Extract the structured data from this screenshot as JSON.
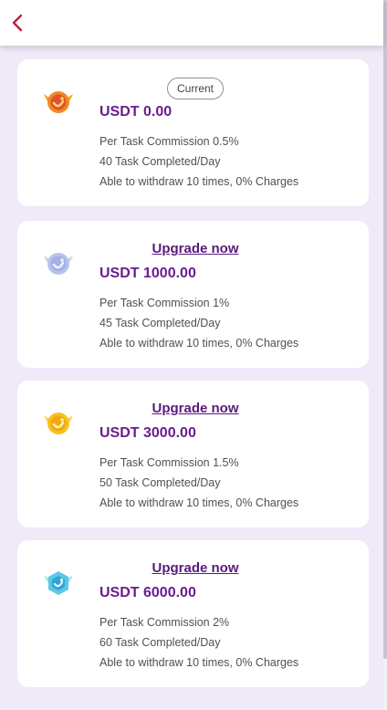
{
  "header": {
    "back_icon": "chevron-left-icon",
    "accent_color": "#c0203a"
  },
  "plans": [
    {
      "icon": "orange-medal-icon",
      "status_label": "Current",
      "price": "USDT 0.00",
      "commission": "Per Task Commission 0.5%",
      "tasks": "40 Task Completed/Day",
      "withdraw": "Able to withdraw 10 times, 0% Charges"
    },
    {
      "icon": "silver-medal-icon",
      "action_label": "Upgrade now",
      "price": "USDT 1000.00",
      "commission": "Per Task Commission 1%",
      "tasks": "45 Task Completed/Day",
      "withdraw": "Able to withdraw 10 times, 0% Charges"
    },
    {
      "icon": "gold-medal-icon",
      "action_label": "Upgrade now",
      "price": "USDT 3000.00",
      "commission": "Per Task Commission 1.5%",
      "tasks": "50 Task Completed/Day",
      "withdraw": "Able to withdraw 10 times, 0% Charges"
    },
    {
      "icon": "diamond-medal-icon",
      "action_label": "Upgrade now",
      "price": "USDT 6000.00",
      "commission": "Per Task Commission 2%",
      "tasks": "60 Task Completed/Day",
      "withdraw": "Able to withdraw 10 times, 0% Charges"
    }
  ],
  "colors": {
    "background": "#efe9f8",
    "price_text": "#6a1d8e",
    "link_text": "#5a1a7a"
  }
}
